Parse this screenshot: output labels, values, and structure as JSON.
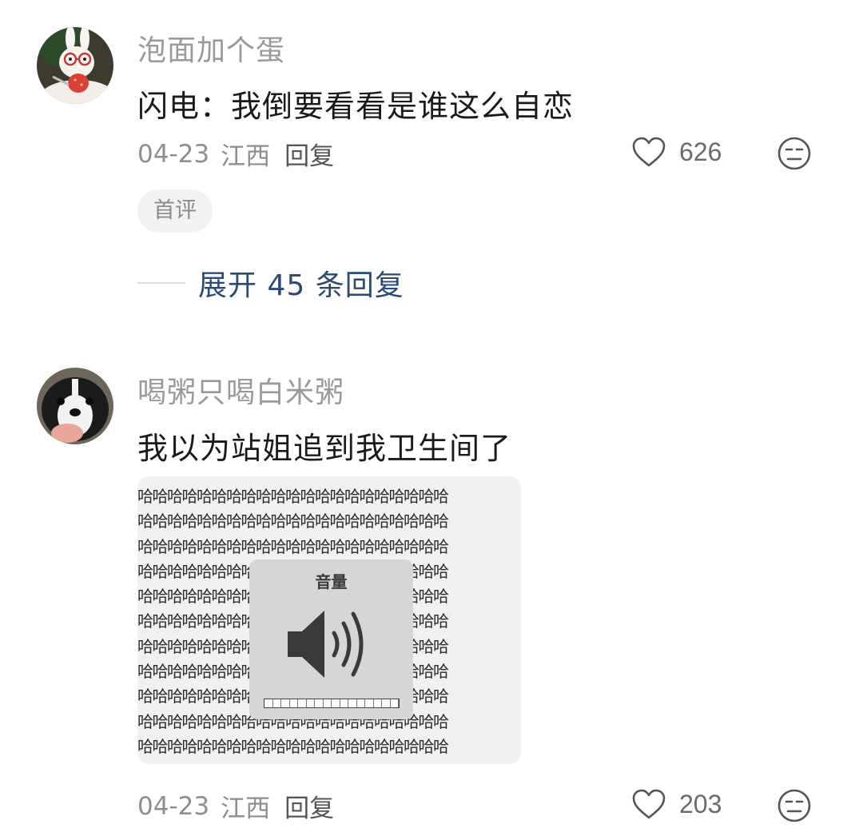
{
  "comments": [
    {
      "avatar_icon": "bunny-avatar-icon",
      "username": "泡面加个蛋",
      "content": "闪电：我倒要看看是谁这么自恋",
      "date": "04-23",
      "location": "江西",
      "reply_label": "回复",
      "likes": "626",
      "badge": "首评",
      "expand_label": "展开 45 条回复"
    },
    {
      "avatar_icon": "puppy-avatar-icon",
      "username": "喝粥只喝白米粥",
      "content": "我以为站姐追到我卫生间了",
      "date": "04-23",
      "location": "江西",
      "reply_label": "回复",
      "likes": "203",
      "meme": {
        "repeat_text": "哈哈哈哈哈哈哈哈哈哈哈哈哈哈哈哈哈哈哈哈哈",
        "hud_title": "音量",
        "volume_level": 1.0
      }
    }
  ],
  "colors": {
    "username": "#9a9a9a",
    "expand_link": "#2b4a75",
    "badge_bg": "#f2f2f2"
  }
}
